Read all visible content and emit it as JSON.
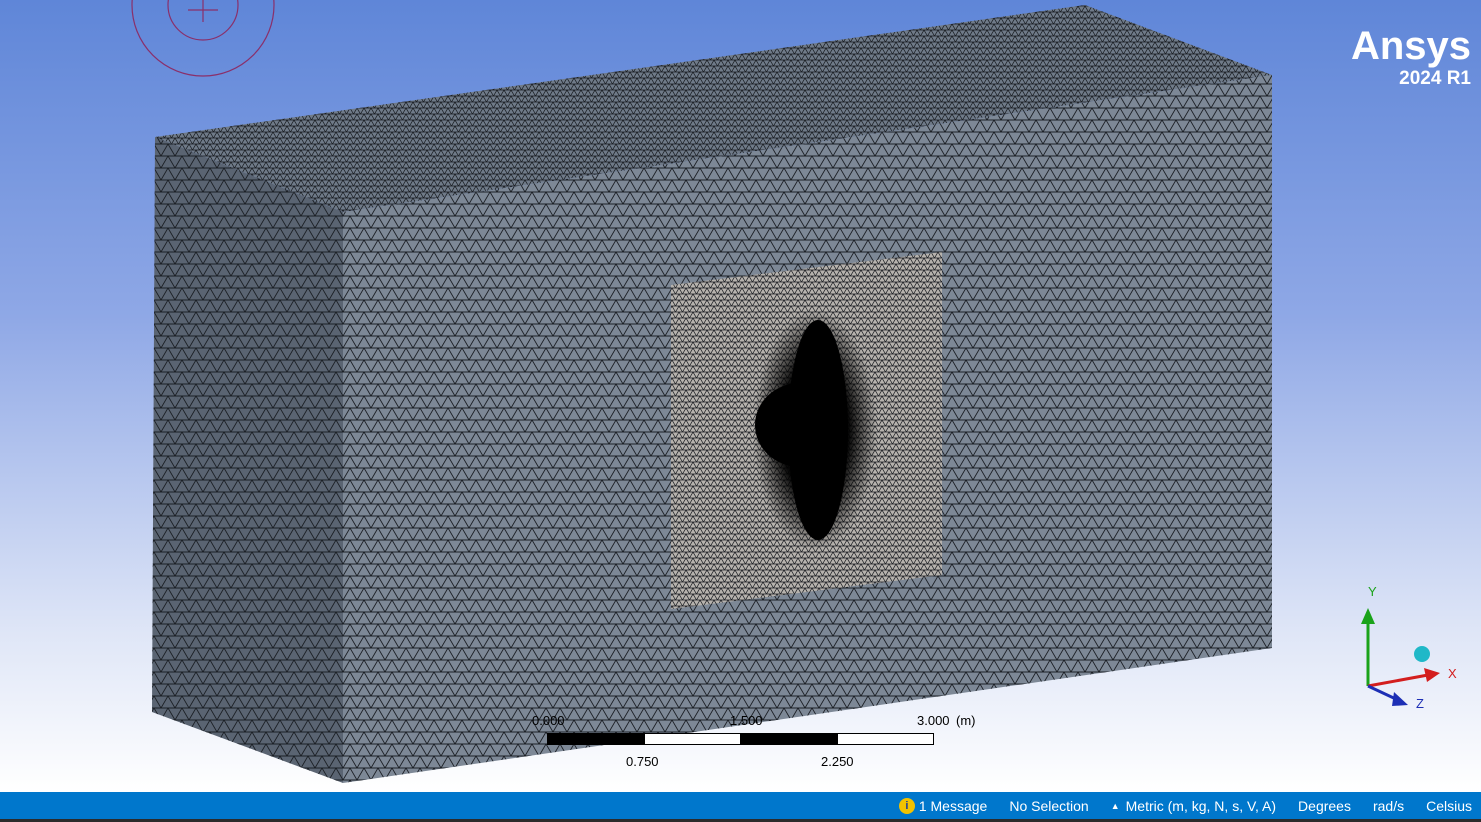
{
  "logo": {
    "name": "Ansys",
    "release": "2024 R1"
  },
  "scale_bar": {
    "unit": "(m)",
    "top_labels": [
      "0.000",
      "1.500",
      "3.000"
    ],
    "bottom_labels": [
      "0.750",
      "2.250"
    ]
  },
  "triad": {
    "x_label": "X",
    "y_label": "Y",
    "z_label": "Z"
  },
  "statusbar": {
    "messages": "1 Message",
    "selection": "No Selection",
    "units": "Metric (m, kg, N, s, V, A)",
    "angle": "Degrees",
    "angular_velocity": "rad/s",
    "temperature": "Celsius"
  },
  "colors": {
    "statusbar": "#0077cc",
    "mesh_face": "#7d8896",
    "refined_region": "#b6b2ad",
    "logo": "#ffffff"
  }
}
